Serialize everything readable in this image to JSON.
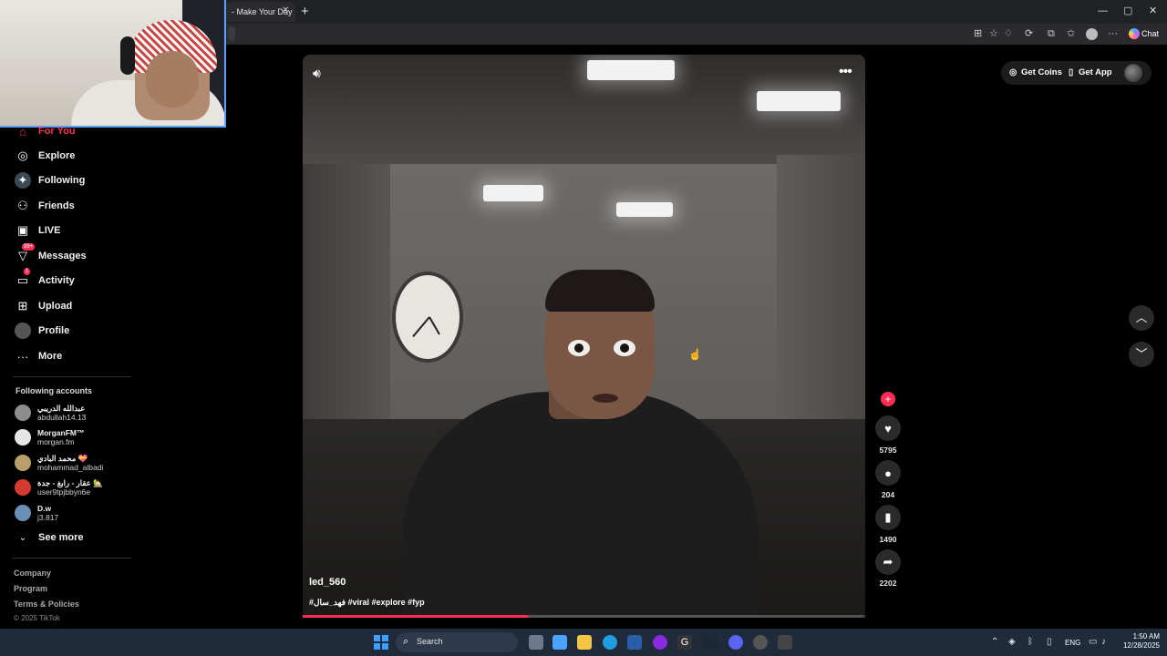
{
  "browser": {
    "tab_title": "- Make Your Day",
    "tab_close": "✕",
    "new_tab": "+",
    "chat_label": "Chat",
    "window_min": "—",
    "window_max": "▢",
    "window_close": "✕"
  },
  "sidebar": {
    "items": [
      {
        "label": "For You",
        "icon": "home-icon"
      },
      {
        "label": "Explore",
        "icon": "compass-icon"
      },
      {
        "label": "Following",
        "icon": "following-icon"
      },
      {
        "label": "Friends",
        "icon": "friends-icon"
      },
      {
        "label": "LIVE",
        "icon": "live-icon"
      },
      {
        "label": "Messages",
        "icon": "messages-icon",
        "badge": "99+"
      },
      {
        "label": "Activity",
        "icon": "activity-icon",
        "badge": "1"
      },
      {
        "label": "Upload",
        "icon": "upload-icon"
      },
      {
        "label": "Profile",
        "icon": "profile-icon"
      },
      {
        "label": "More",
        "icon": "more-icon"
      }
    ],
    "following_title": "Following accounts",
    "accounts": [
      {
        "name": "عبدالله الدريبي",
        "username": "abdullah14.13",
        "color": "#8d8d8d"
      },
      {
        "name": "MorganFM™",
        "username": "morgan.fm",
        "color": "#e6e6e6"
      },
      {
        "name": "محمد البادي 💝",
        "username": "mohammad_albadi",
        "color": "#b9a06a"
      },
      {
        "name": "عقار - رابغ - جدة 🏡",
        "username": "user9tpjbbyn6e",
        "color": "#d43a2f"
      },
      {
        "name": "D.w",
        "username": "j3.817",
        "color": "#6a8fb5"
      }
    ],
    "see_more": "See more",
    "footer": [
      "Company",
      "Program",
      "Terms & Policies"
    ],
    "copyright": "© 2025 TikTok"
  },
  "video": {
    "author": "led_560",
    "caption": "#فهد_سال #viral #explore #fyp",
    "progress": 0.4
  },
  "actions": {
    "likes": "5795",
    "comments": "204",
    "saves": "1490",
    "shares": "2202"
  },
  "topbar": {
    "get_coins": "Get Coins",
    "get_app": "Get App"
  },
  "taskbar": {
    "search_label": "Search",
    "language": "ENG",
    "time": "1:50 AM",
    "date": "12/28/2025"
  },
  "colors": {
    "accent": "#fe2c55",
    "background": "#000000",
    "taskbar": "#1f2a3a"
  }
}
